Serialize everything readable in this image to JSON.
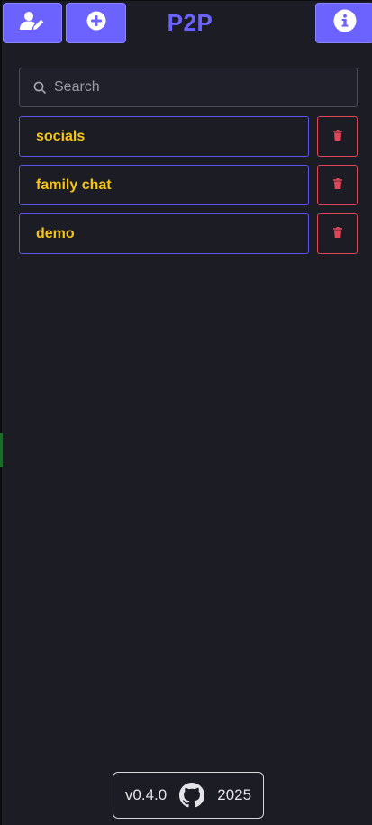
{
  "header": {
    "title": "P2P",
    "edit_user_icon": "user-edit-icon",
    "add_icon": "plus-circle-icon",
    "info_icon": "info-circle-icon"
  },
  "search": {
    "placeholder": "Search",
    "value": ""
  },
  "chats": [
    {
      "name": "socials"
    },
    {
      "name": "family chat"
    },
    {
      "name": "demo"
    }
  ],
  "footer": {
    "version": "v0.4.0",
    "year": "2025",
    "icon": "github-icon"
  },
  "colors": {
    "background": "#1b1c24",
    "accent": "#6c63ff",
    "chat_text": "#f5c518",
    "chat_border": "#5b55e8",
    "delete": "#e0465a"
  }
}
